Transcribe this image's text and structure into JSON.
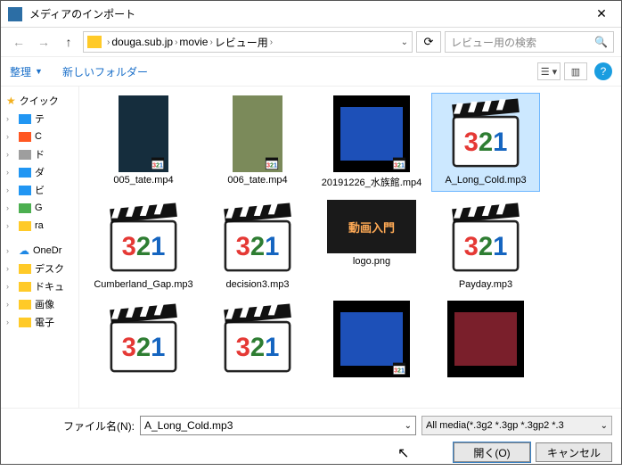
{
  "title": "メディアのインポート",
  "breadcrumb": {
    "seg1": "douga.sub.jp",
    "seg2": "movie",
    "seg3": "レビュー用"
  },
  "search_placeholder": "レビュー用の検索",
  "toolbar": {
    "organize": "整理",
    "newfolder": "新しいフォルダー"
  },
  "sidebar": {
    "quick": "クイック",
    "items": [
      "テ",
      "C",
      "ド",
      "ダ",
      "ビ",
      "G",
      "ra"
    ],
    "onedrive": "OneDr",
    "o_items": [
      "デスク",
      "ドキュ",
      "画像",
      "電子"
    ]
  },
  "files": [
    {
      "name": "005_tate.mp4",
      "kind": "photo-tate",
      "sel": false
    },
    {
      "name": "006_tate.mp4",
      "kind": "photo-tate2",
      "sel": false
    },
    {
      "name": "20191226_水族館.mp4",
      "kind": "film-aqua",
      "sel": false
    },
    {
      "name": "A_Long_Cold.mp3",
      "kind": "clap",
      "sel": true
    },
    {
      "name": "Cumberland_Gap.mp3",
      "kind": "clap",
      "sel": false
    },
    {
      "name": "decision3.mp3",
      "kind": "clap",
      "sel": false
    },
    {
      "name": "logo.png",
      "kind": "logo",
      "sel": false
    },
    {
      "name": "Payday.mp3",
      "kind": "clap",
      "sel": false
    },
    {
      "name": "",
      "kind": "clap",
      "sel": false
    },
    {
      "name": "",
      "kind": "clap",
      "sel": false
    },
    {
      "name": "",
      "kind": "film-aqua",
      "sel": false
    },
    {
      "name": "",
      "kind": "photo-red",
      "sel": false
    }
  ],
  "footer": {
    "label": "ファイル名(N):",
    "value": "A_Long_Cold.mp3",
    "filter": "All media(*.3g2 *.3gp *.3gp2 *.3",
    "open": "開く(O)",
    "cancel": "キャンセル"
  },
  "logo_text": "動画入門"
}
